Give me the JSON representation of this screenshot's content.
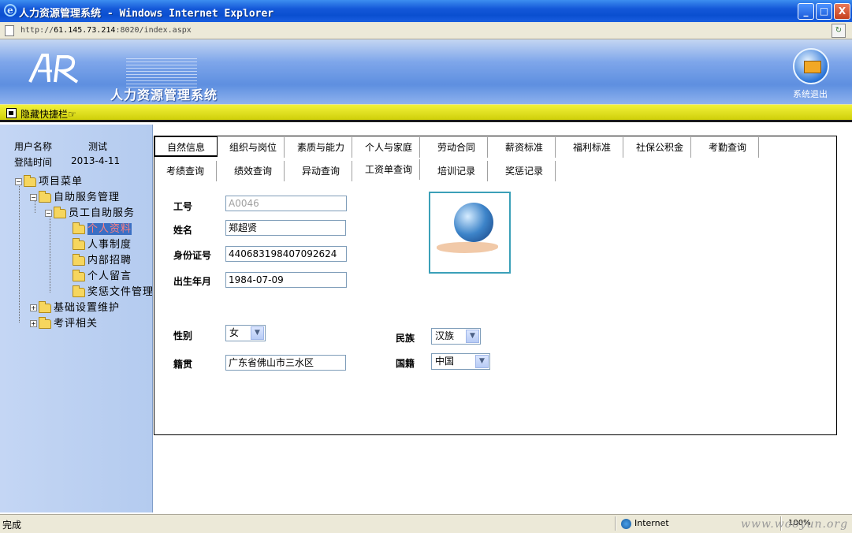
{
  "window": {
    "title": "人力资源管理系统 - Windows Internet Explorer",
    "min": "_",
    "max": "□",
    "close": "X"
  },
  "address": {
    "prefix": "http://",
    "host": "61.145.73.214",
    "rest": ":8020/index.aspx"
  },
  "banner": {
    "logo_text": "AR",
    "system_name": "人力资源管理系统",
    "exit_label": "系统退出"
  },
  "shortcut": {
    "label": "隐藏快捷栏☞"
  },
  "sidebar": {
    "user_label": "用户名称",
    "user_value": "测试",
    "login_label": "登陆时间",
    "login_value": "2013-4-11",
    "tree": {
      "root": "项目菜单",
      "self_service": "自助服务管理",
      "employee": "员工自助服务",
      "leaves": [
        "个人资料",
        "人事制度",
        "内部招聘",
        "个人留言",
        "奖惩文件管理"
      ],
      "basic": "基础设置维护",
      "review": "考评相关"
    }
  },
  "tabs": {
    "row1": [
      "自然信息",
      "组织与岗位",
      "素质与能力",
      "个人与家庭",
      "劳动合同",
      "薪资标准",
      "福利标准",
      "社保公积金",
      "考勤查询"
    ],
    "row2": [
      "考绩查询",
      "绩效查询",
      "异动查询",
      "工资单查询",
      "培训记录",
      "奖惩记录"
    ]
  },
  "form": {
    "emp_no": {
      "label": "工号",
      "value": "A0046"
    },
    "name": {
      "label": "姓名",
      "value": "郑超贤"
    },
    "id_no": {
      "label": "身份证号",
      "value": "440683198407092624"
    },
    "birth": {
      "label": "出生年月",
      "value": "1984-07-09"
    },
    "gender": {
      "label": "性别",
      "value": "女"
    },
    "ethnic": {
      "label": "民族",
      "value": "汉族"
    },
    "native": {
      "label": "籍贯",
      "value": "广东省佛山市三水区"
    },
    "nationality": {
      "label": "国籍",
      "value": "中国"
    }
  },
  "status": {
    "text": "完成",
    "zone": "Internet",
    "zoom": "100%"
  },
  "watermark": "www.wooyun.org"
}
